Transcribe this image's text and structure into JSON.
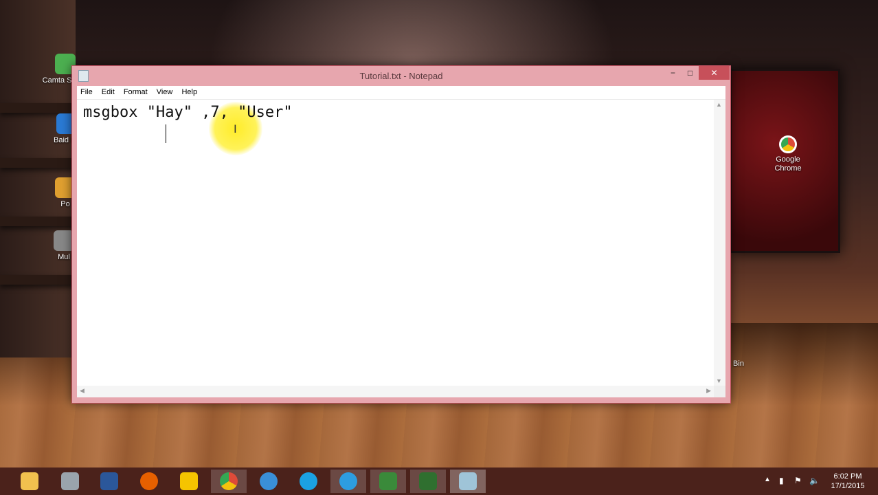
{
  "window": {
    "title": "Tutorial.txt - Notepad",
    "minimize": "−",
    "maximize": "□",
    "close": "✕"
  },
  "menu": [
    "File",
    "Edit",
    "Format",
    "View",
    "Help"
  ],
  "editor": {
    "content": "msgbox \"Hay\" ,7, \"User\""
  },
  "desktop_icons": [
    {
      "label": "Camta Studio",
      "icon": "camtasia-icon",
      "color": "#4caf50"
    },
    {
      "label": "Baid Fa",
      "icon": "baidu-icon",
      "color": "#2a7ad4"
    },
    {
      "label": "Po",
      "icon": "folder-icon",
      "color": "#e0a030"
    },
    {
      "label": "Mul",
      "icon": "app-icon",
      "color": "#888888"
    },
    {
      "label": "Google Chrome",
      "icon": "chrome-icon",
      "color": "#dd4b39"
    },
    {
      "label": "Bin",
      "icon": "recycle-bin-icon",
      "color": "#cccccc"
    }
  ],
  "taskbar": {
    "items": [
      {
        "icon": "file-explorer-icon",
        "color": "#f2c14e"
      },
      {
        "icon": "settings-tool-icon",
        "color": "#9aa4ac"
      },
      {
        "icon": "word-icon",
        "color": "#2b579a"
      },
      {
        "icon": "firefox-icon",
        "color": "#e66000"
      },
      {
        "icon": "puzzle-app-icon",
        "color": "#f5c400"
      },
      {
        "icon": "chrome-icon",
        "color": "#34a853"
      },
      {
        "icon": "network-globe-icon",
        "color": "#3a8fd8"
      },
      {
        "icon": "internet-explorer-icon",
        "color": "#1ba1e2"
      },
      {
        "icon": "lightning-app-icon",
        "color": "#2d9de0"
      },
      {
        "icon": "camtasia-recorder-icon",
        "color": "#3a8a3a"
      },
      {
        "icon": "camtasia-studio-icon",
        "color": "#2f6f2f"
      },
      {
        "icon": "notepad-icon",
        "color": "#9fc4d8"
      }
    ],
    "time": "6:02 PM",
    "date": "17/1/2015"
  }
}
